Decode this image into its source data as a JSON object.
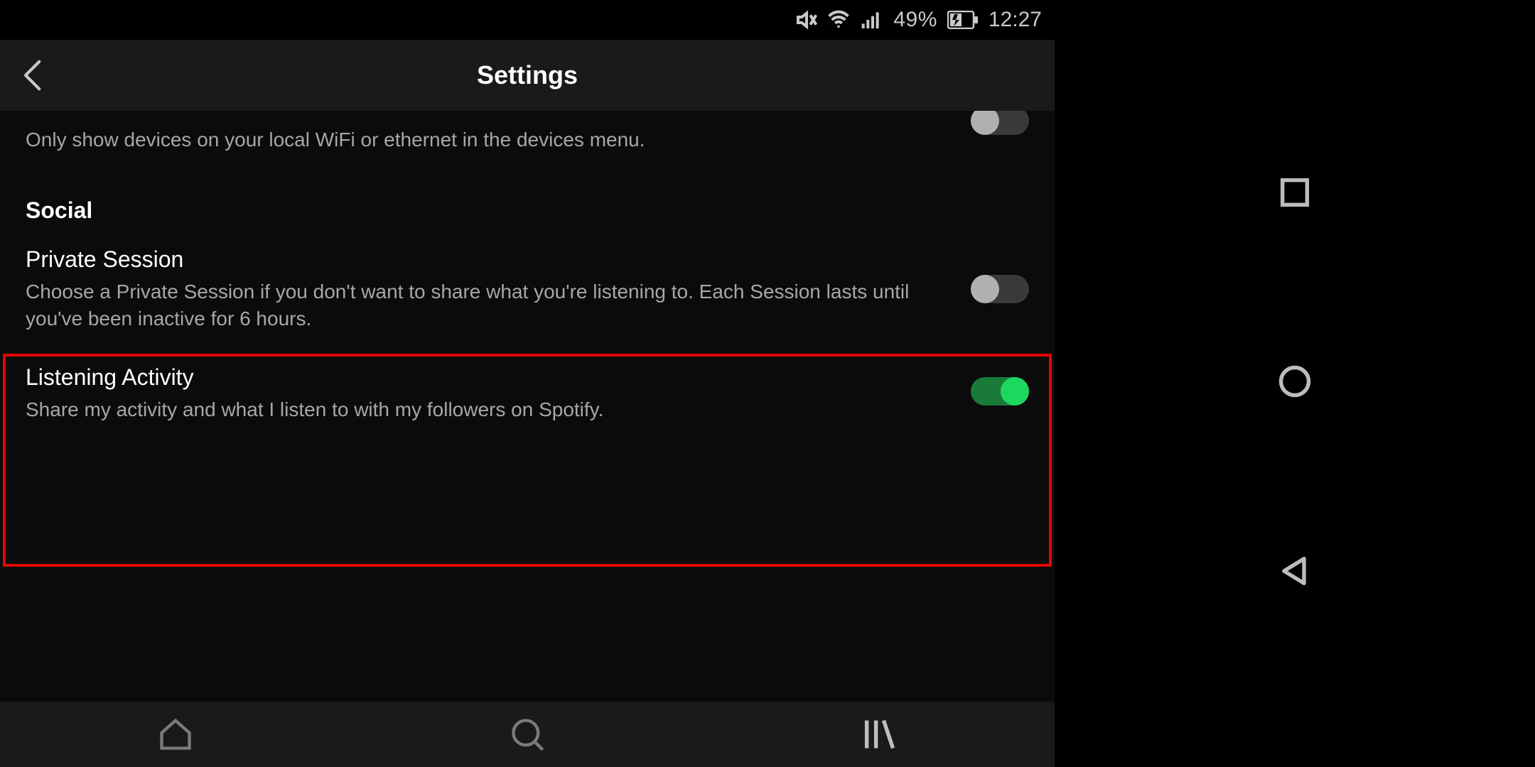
{
  "status": {
    "battery_text": "49%",
    "time": "12:27"
  },
  "header": {
    "title": "Settings"
  },
  "partial": {
    "desc": "Only show devices on your local WiFi or ethernet in the devices menu.",
    "toggle_on": false
  },
  "sections": {
    "social": {
      "title": "Social",
      "private_session": {
        "title": "Private Session",
        "desc": "Choose a Private Session if you don't want to share what you're listening to. Each Session lasts until you've been inactive for 6 hours.",
        "toggle_on": false
      },
      "listening_activity": {
        "title": "Listening Activity",
        "desc": "Share my activity and what I listen to with my followers on Spotify.",
        "toggle_on": true
      }
    }
  },
  "colors": {
    "accent_green": "#1ed760",
    "highlight_red": "#e10505"
  }
}
